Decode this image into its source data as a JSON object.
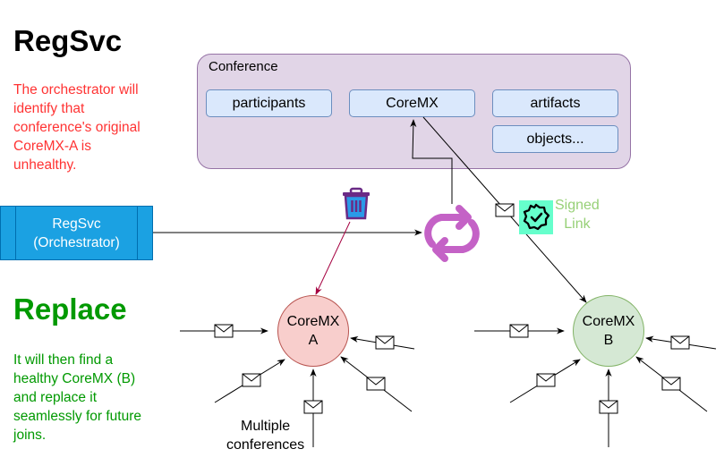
{
  "left_panel": {
    "section1": {
      "title": "RegSvc",
      "title_color": "#000000",
      "description": [
        "The orchestrator will",
        "identify that",
        "conference's original",
        "CoreMX-A is",
        "unhealthy."
      ],
      "description_color": "#ff3333"
    },
    "section2": {
      "title": "Replace",
      "title_color": "#009900",
      "description": [
        "It will then find a",
        "healthy CoreMX (B)",
        "and replace it",
        "seamlessly for future",
        "joins."
      ],
      "description_color": "#009900"
    }
  },
  "conference": {
    "label": "Conference",
    "items": [
      {
        "label": "participants"
      },
      {
        "label": "CoreMX"
      },
      {
        "label": "artifacts"
      },
      {
        "label": "objects..."
      }
    ],
    "fill": "#e1d5e7",
    "stroke": "#9673a6"
  },
  "orchestrator": {
    "lines": [
      "RegSvc",
      "(Orchestrator)"
    ],
    "fill": "#1ba1e2"
  },
  "icons": {
    "trash": "trash-icon",
    "replace_cycle": "refresh-cycle-icon",
    "signed_badge": "verified-badge-icon",
    "message": "envelope-icon"
  },
  "signed_link": {
    "lines": [
      "Signed",
      "Link"
    ],
    "color": "#97d077",
    "badge_bg": "#66ffcc"
  },
  "nodes": [
    {
      "id": "A",
      "lines": [
        "CoreMX",
        "A"
      ],
      "fill": "#f8cecc",
      "stroke": "#b85450",
      "status": "unhealthy"
    },
    {
      "id": "B",
      "lines": [
        "CoreMX",
        "B"
      ],
      "fill": "#d5e8d4",
      "stroke": "#82b366",
      "status": "healthy"
    }
  ],
  "multiple_conferences_label": [
    "Multiple",
    "conferences"
  ],
  "colors": {
    "cycle_icon": "#c462c6",
    "delete_edge": "#a50040"
  }
}
